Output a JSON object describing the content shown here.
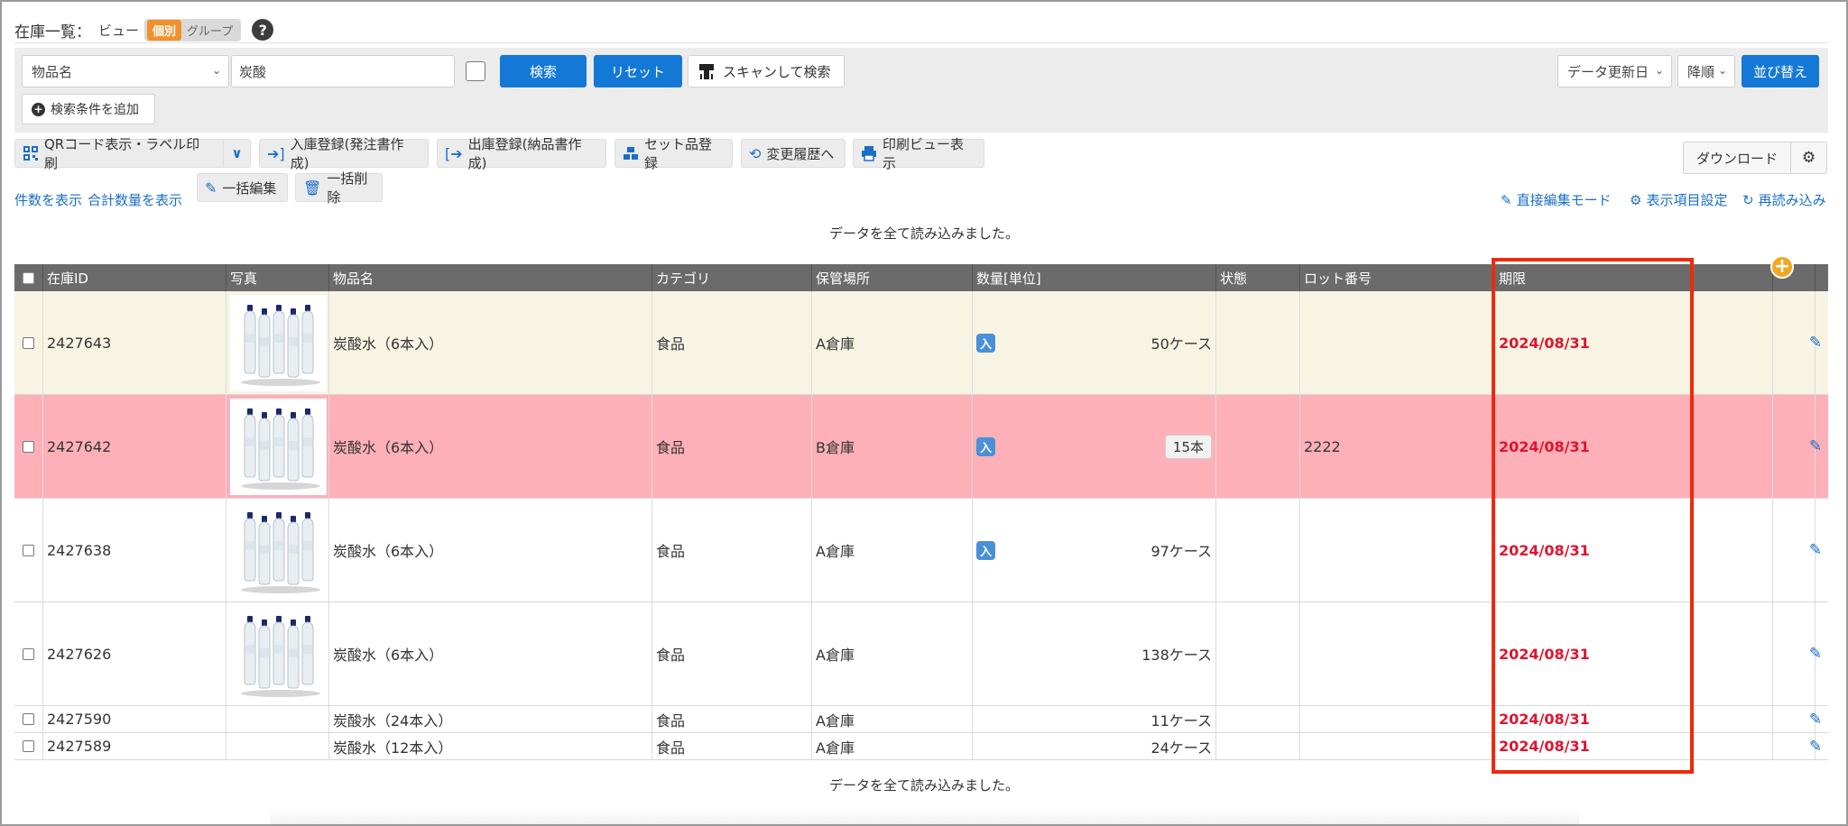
{
  "page": {
    "title": "在庫一覧：",
    "view_label": "ビュー",
    "view_options": [
      "個別",
      "グループ"
    ],
    "help": "?"
  },
  "search": {
    "field_select": "物品名",
    "keyword": "炭酸",
    "search_button": "検索",
    "reset_button": "リセット",
    "scan_button": "スキャンして検索",
    "sort_field": "データ更新日",
    "sort_order": "降順",
    "sort_button": "並び替え",
    "add_condition": "検索条件を追加"
  },
  "toolbar": {
    "qr": "QRコード表示・ラベル印刷",
    "inbound": "入庫登録(発注書作成)",
    "outbound": "出庫登録(納品書作成)",
    "set": "セット品登録",
    "history": "変更履歴へ",
    "print_view": "印刷ビュー表示",
    "bulk_edit": "一括編集",
    "bulk_delete": "一括削除",
    "download": "ダウンロード"
  },
  "links": {
    "show_count": "件数を表示",
    "show_total": "合計数量を表示",
    "direct_edit": "直接編集モード",
    "column_settings": "表示項目設定",
    "reload": "再読み込み"
  },
  "status_message": "データを全て読み込みました。",
  "table": {
    "columns": [
      "在庫ID",
      "写真",
      "物品名",
      "カテゴリ",
      "保管場所",
      "数量[単位]",
      "状態",
      "ロット番号",
      "期限"
    ],
    "in_badge": "入",
    "rows": [
      {
        "id": "2427643",
        "name": "炭酸水（6本入）",
        "category": "食品",
        "location": "A倉庫",
        "qty": "50ケース",
        "lot": "",
        "expiry": "2024/08/31",
        "bg": "#f7f4e3"
      },
      {
        "id": "2427642",
        "name": "炭酸水（6本入）",
        "category": "食品",
        "location": "B倉庫",
        "qty": "15本",
        "lot": "2222",
        "expiry": "2024/08/31",
        "bg": "#fdb0b8"
      },
      {
        "id": "2427638",
        "name": "炭酸水（6本入）",
        "category": "食品",
        "location": "A倉庫",
        "qty": "97ケース",
        "lot": "",
        "expiry": "2024/08/31",
        "bg": "#ffffff"
      },
      {
        "id": "2427626",
        "name": "炭酸水（6本入）",
        "category": "食品",
        "location": "A倉庫",
        "qty": "138ケース",
        "lot": "",
        "expiry": "2024/08/31",
        "bg": "#ffffff"
      },
      {
        "id": "2427590",
        "name": "炭酸水（24本入）",
        "category": "食品",
        "location": "A倉庫",
        "qty": "11ケース",
        "lot": "",
        "expiry": "2024/08/31",
        "bg": "#ffffff"
      },
      {
        "id": "2427589",
        "name": "炭酸水（12本入）",
        "category": "食品",
        "location": "A倉庫",
        "qty": "24ケース",
        "lot": "",
        "expiry": "2024/08/31",
        "bg": "#ffffff"
      }
    ]
  },
  "colors": {
    "accent": "#1479d6",
    "expiry": "#e0142e",
    "highlight": "#ee2a0c",
    "group_badge": "#f0912c"
  }
}
